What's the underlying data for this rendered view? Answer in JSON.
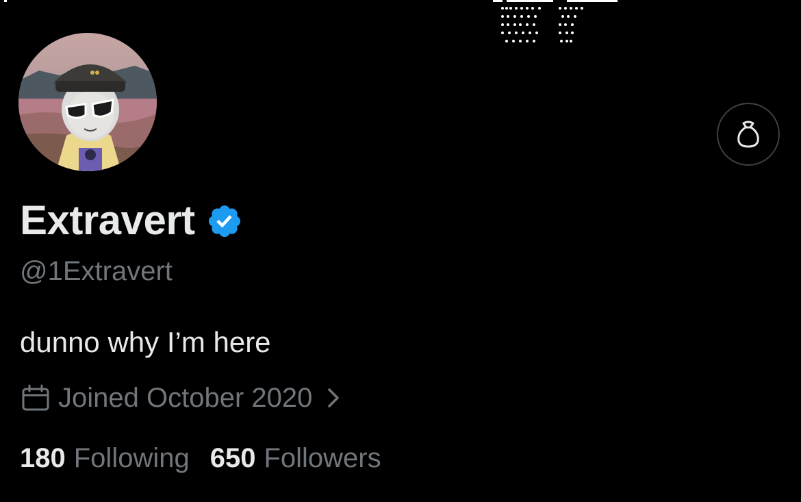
{
  "profile": {
    "display_name": "Extravert",
    "handle": "@1Extravert",
    "bio": "dunno why I’m here",
    "joined": "Joined October 2020",
    "verified_icon": "verified-badge-icon",
    "verified_color": "#1d9bf0"
  },
  "stats": {
    "following_count": "180",
    "following_label": "Following",
    "followers_count": "650",
    "followers_label": "Followers"
  },
  "actions": {
    "top_right_icon": "bag-icon"
  },
  "colors": {
    "background": "#000000",
    "primary_text": "#e7e9ea",
    "secondary_text": "#71767b",
    "border": "#3e4144"
  }
}
